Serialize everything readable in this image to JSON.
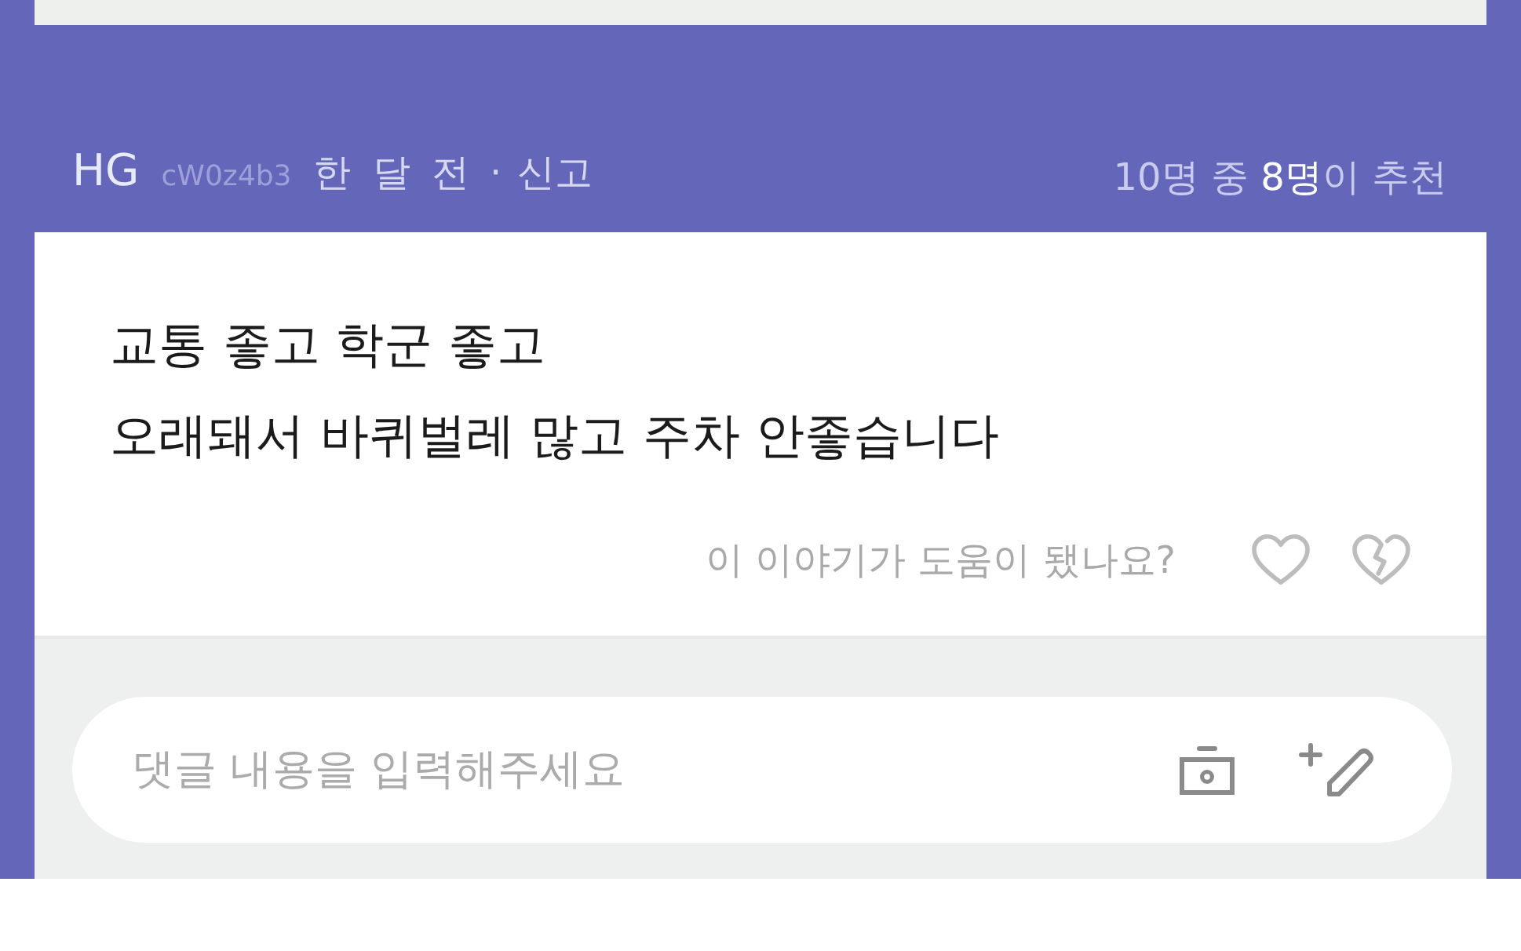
{
  "review": {
    "author": "HG",
    "user_id": "cW0z4b3",
    "time": "한 달 전",
    "separator": "·",
    "report_link": "신고",
    "recommend": "10명 중 **8명**이 추천",
    "body": "교통 좋고 학군 좋고\n오래돼서 바퀴벌레 많고 주차 안좋습니다",
    "helpful_prompt": "이 이야기가 도움이 됐나요?"
  },
  "comment_box": {
    "placeholder": "댓글 내용을 입력해주세요"
  }
}
